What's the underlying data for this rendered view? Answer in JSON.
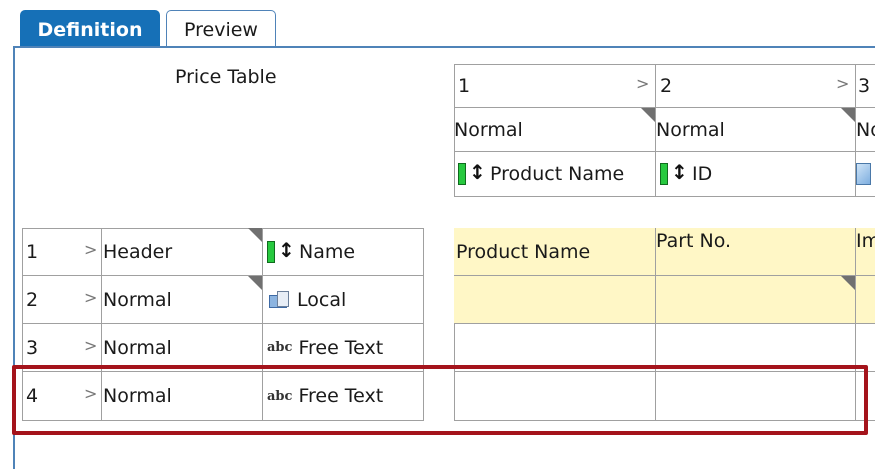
{
  "tabs": [
    {
      "label": "Definition",
      "active": true
    },
    {
      "label": "Preview",
      "active": false
    }
  ],
  "title": "Price Table",
  "columns": [
    {
      "number": "1",
      "style": "Normal",
      "field": "Product Name"
    },
    {
      "number": "2",
      "style": "Normal",
      "field": "ID"
    },
    {
      "number": "3",
      "style": "No",
      "field": ""
    }
  ],
  "rows": [
    {
      "number": "4",
      "style": "Normal",
      "type": "Free Text"
    },
    {
      "number": "1",
      "style": "Header",
      "type": "Name"
    },
    {
      "number": "2",
      "style": "Normal",
      "type": "Local"
    },
    {
      "number": "3",
      "style": "Normal",
      "type": "Free Text"
    }
  ],
  "preview_header": [
    "Product Name",
    "Part No.",
    "Im"
  ],
  "colors": {
    "tab_active": "#1670b7",
    "highlight": "#a4131b",
    "header_fill": "#fff7c6"
  }
}
